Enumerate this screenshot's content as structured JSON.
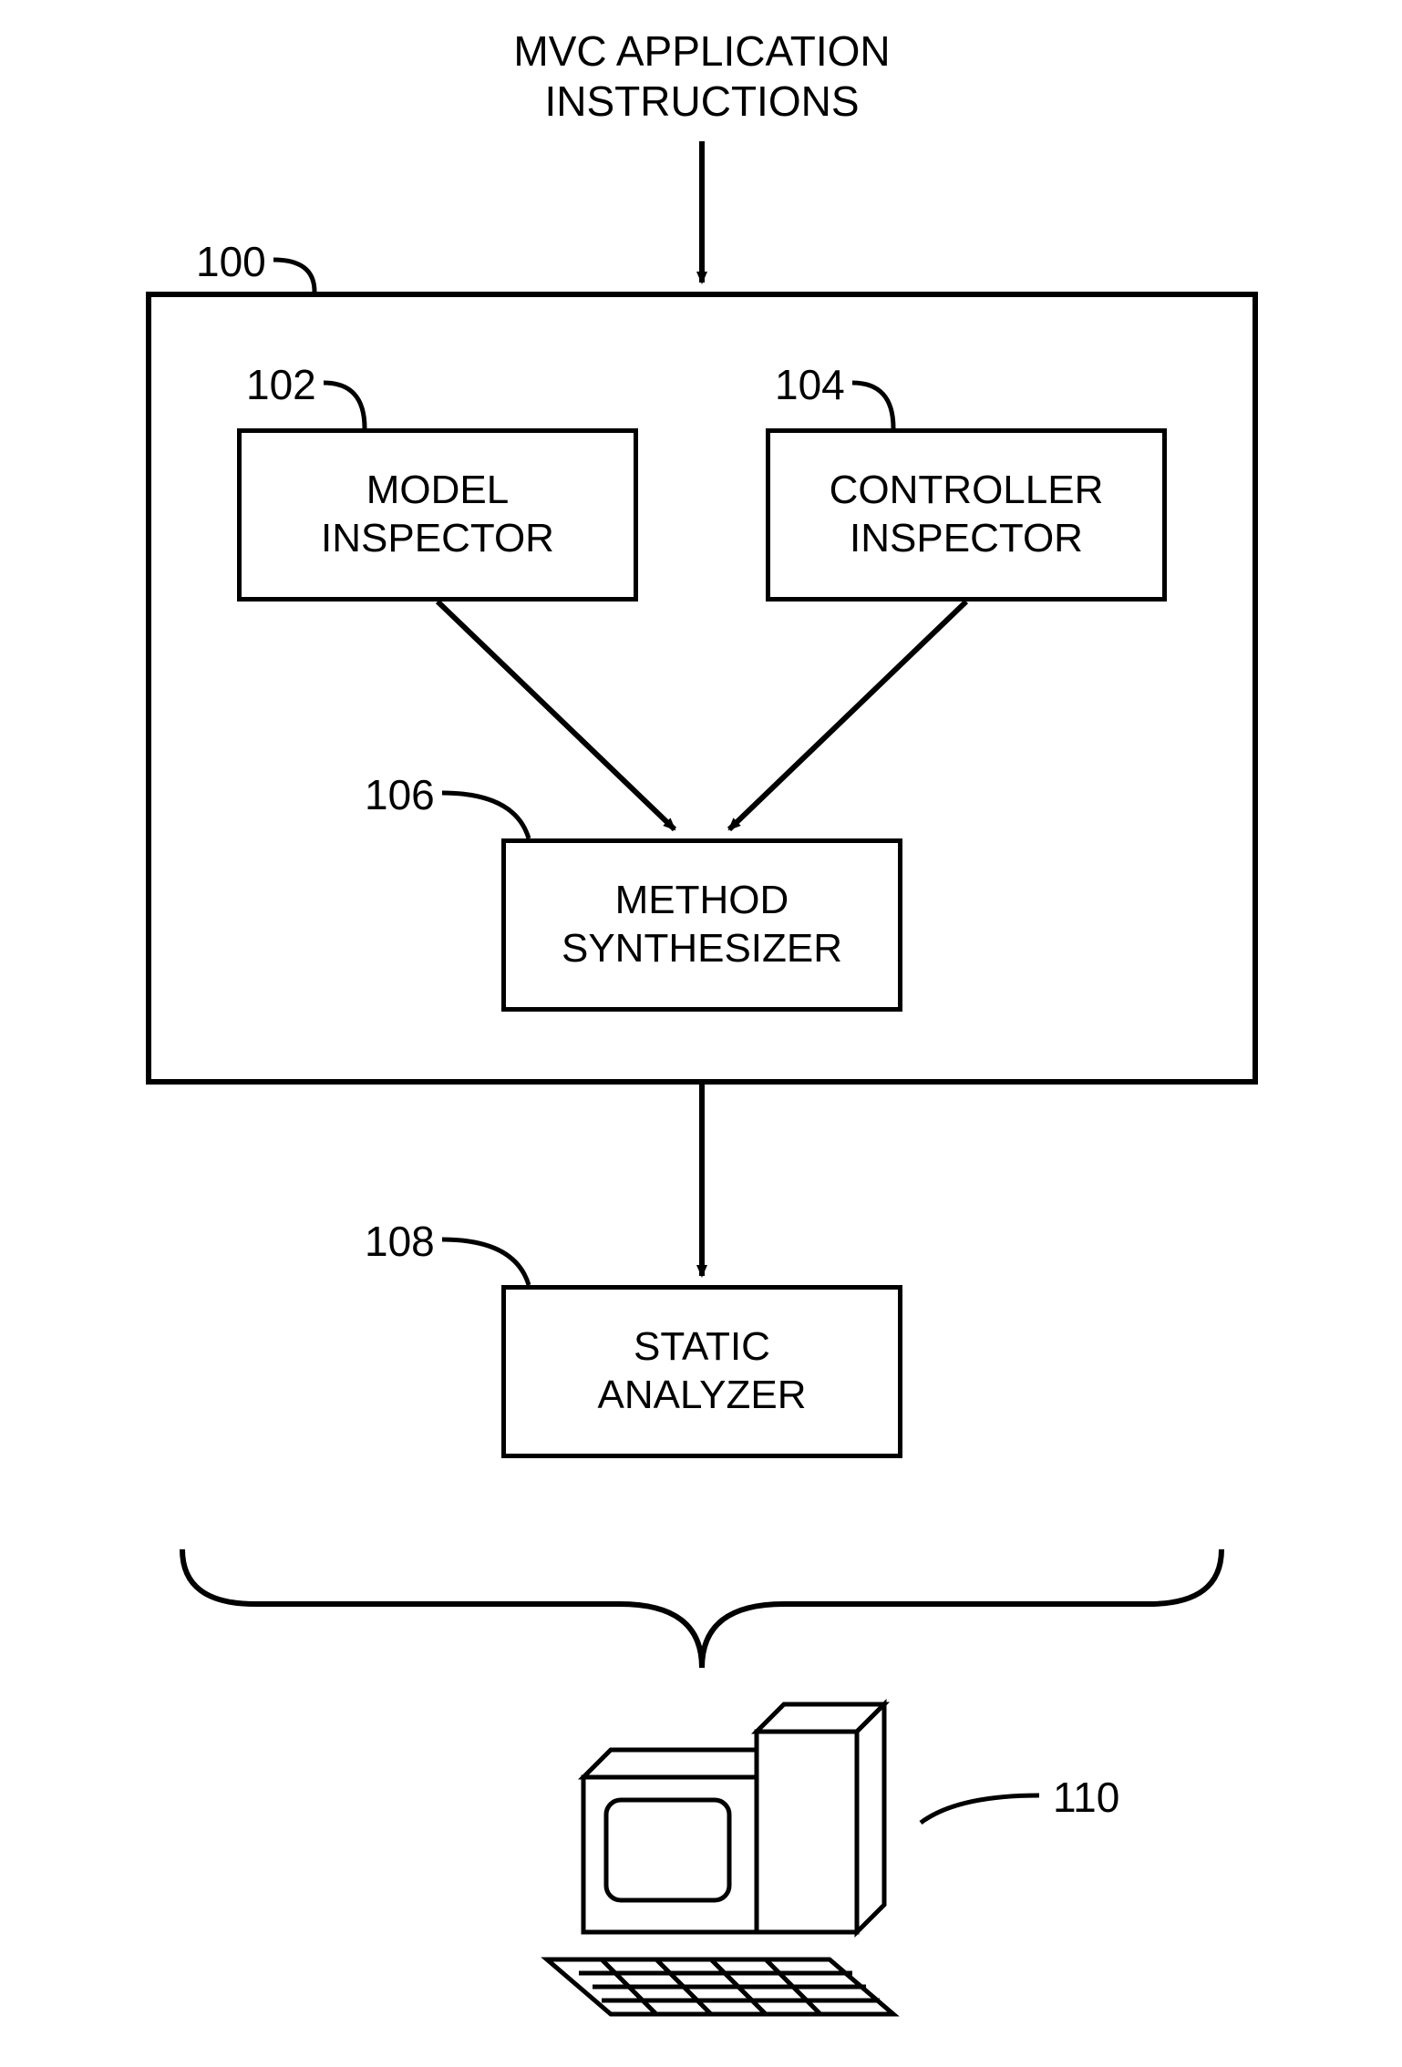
{
  "title": {
    "line1": "MVC APPLICATION",
    "line2": "INSTRUCTIONS"
  },
  "refs": {
    "container": "100",
    "model_inspector": "102",
    "controller_inspector": "104",
    "method_synthesizer": "106",
    "static_analyzer": "108",
    "computer": "110"
  },
  "boxes": {
    "model_inspector": "MODEL\nINSPECTOR",
    "controller_inspector": "CONTROLLER\nINSPECTOR",
    "method_synthesizer": "METHOD\nSYNTHESIZER",
    "static_analyzer": "STATIC\nANALYZER"
  }
}
